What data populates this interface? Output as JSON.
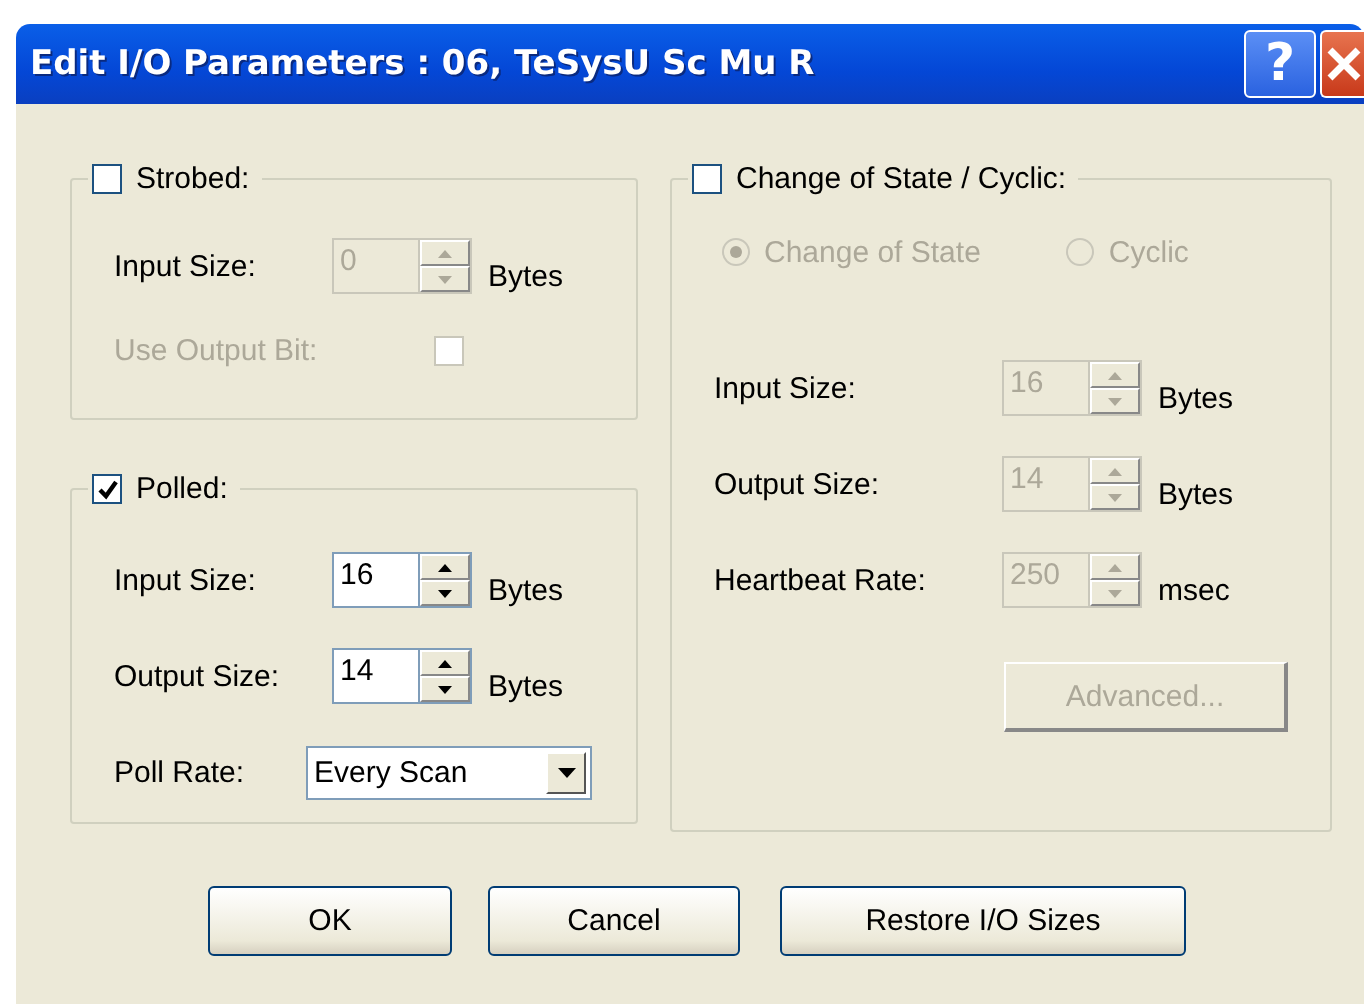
{
  "window": {
    "title": "Edit I/O Parameters : 06, TeSysU Sc Mu R",
    "help_button": "?"
  },
  "groups": [
    {
      "kind": "strobed",
      "label": "Strobed:",
      "checked": false,
      "fields": [
        {
          "kind": "spin",
          "label": "Input Size:",
          "value": "0",
          "unit": "Bytes",
          "disabled": true
        },
        {
          "kind": "checkbox",
          "label": "Use Output Bit:",
          "checked": false,
          "disabled": true
        }
      ]
    },
    {
      "kind": "polled",
      "label": "Polled:",
      "checked": true,
      "fields": [
        {
          "kind": "spin",
          "label": "Input Size:",
          "value": "16",
          "unit": "Bytes",
          "disabled": false
        },
        {
          "kind": "spin",
          "label": "Output Size:",
          "value": "14",
          "unit": "Bytes",
          "disabled": false
        },
        {
          "kind": "dropdown",
          "label": "Poll Rate:",
          "value": "Every Scan",
          "disabled": false
        }
      ]
    },
    {
      "kind": "cos",
      "label": "Change of State / Cyclic:",
      "checked": false,
      "options": [
        {
          "label": "Change of State",
          "selected": true,
          "disabled": true
        },
        {
          "label": "Cyclic",
          "selected": false,
          "disabled": true
        }
      ],
      "fields": [
        {
          "kind": "spin",
          "label": "Input Size:",
          "value": "16",
          "unit": "Bytes",
          "disabled": true
        },
        {
          "kind": "spin",
          "label": "Output Size:",
          "value": "14",
          "unit": "Bytes",
          "disabled": true
        },
        {
          "kind": "spin",
          "label": "Heartbeat Rate:",
          "value": "250",
          "unit": "msec",
          "disabled": true
        }
      ],
      "button": {
        "label": "Advanced...",
        "disabled": true
      }
    }
  ],
  "buttons": [
    {
      "label": "OK"
    },
    {
      "label": "Cancel"
    },
    {
      "label": "Restore I/O Sizes"
    }
  ]
}
